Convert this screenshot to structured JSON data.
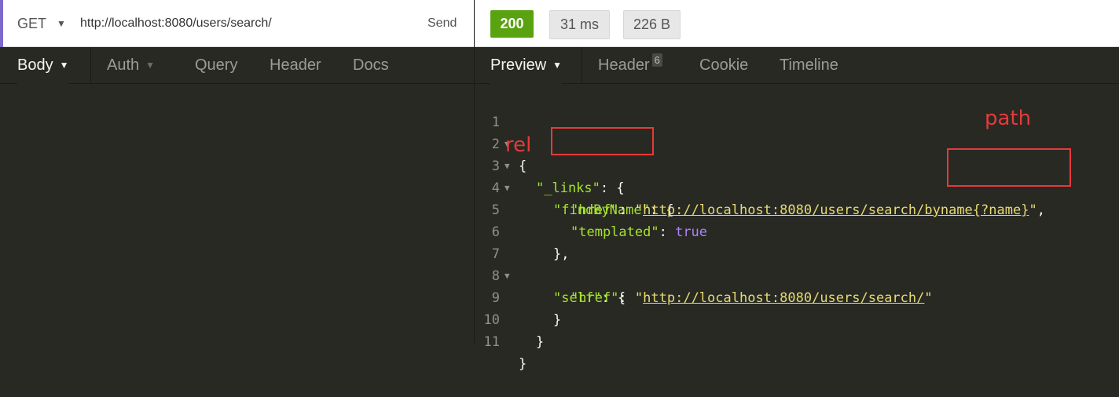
{
  "request": {
    "method": "GET",
    "url": "http://localhost:8080/users/search/",
    "send_label": "Send",
    "tabs": [
      {
        "label": "Body"
      },
      {
        "label": "Auth"
      },
      {
        "label": "Query"
      },
      {
        "label": "Header"
      },
      {
        "label": "Docs"
      }
    ]
  },
  "response": {
    "status": "200",
    "time": "31 ms",
    "size": "226 B",
    "tabs": [
      {
        "label": "Preview"
      },
      {
        "label": "Header",
        "count": "6"
      },
      {
        "label": "Cookie"
      },
      {
        "label": "Timeline"
      }
    ],
    "line_numbers": [
      "1",
      "2",
      "3",
      "4",
      "5",
      "6",
      "7",
      "8",
      "9",
      "10",
      "11"
    ],
    "code": {
      "l1": "{",
      "l2_key": "\"_links\"",
      "l2_rest": ": {",
      "l3_key": "\"findByName\"",
      "l3_rest": ": {",
      "l4_key": "\"href\"",
      "l4_colon": ": ",
      "l4_q1": "\"",
      "l4_link": "http://localhost:8080/users/search/byname{?name}",
      "l4_q2": "\"",
      "l4_end": ",",
      "l5_key": "\"templated\"",
      "l5_colon": ": ",
      "l5_val": "true",
      "l6": "},",
      "l7_key": "\"self\"",
      "l7_rest": ": {",
      "l8_key": "\"href\"",
      "l8_colon": ": ",
      "l8_q1": "\"",
      "l8_link": "http://localhost:8080/users/search/",
      "l8_q2": "\"",
      "l9": "}",
      "l10": "}",
      "l11": "}"
    }
  },
  "annotations": {
    "rel_label": "rel",
    "path_label": "path"
  },
  "colors": {
    "status_ok": "#59a210",
    "annotation_red": "#e63a3a",
    "editor_bg": "#282923",
    "json_key": "#a6e22e",
    "json_string": "#e6db74",
    "json_bool": "#ae81ff"
  }
}
